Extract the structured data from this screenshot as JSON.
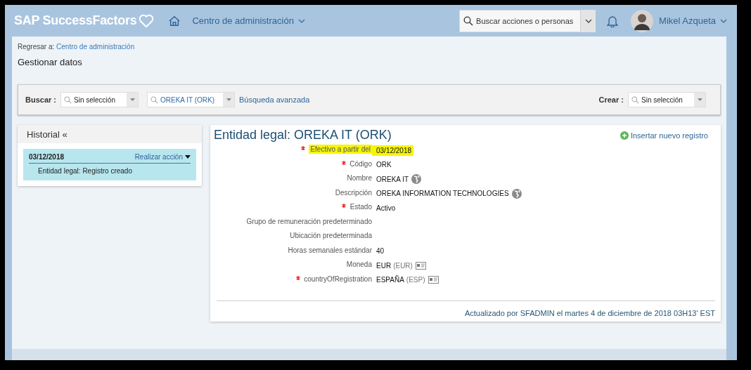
{
  "header": {
    "logo": "SAP SuccessFactors",
    "nav": "Centro de administración",
    "search": {
      "placeholder": "Buscar acciones o personas"
    },
    "user": "Mikel Azqueta"
  },
  "breadcrumb": {
    "label": "Regresar a:",
    "link": "Centro de administración"
  },
  "page_title": "Gestionar datos",
  "toolbar": {
    "search_label": "Buscar :",
    "search_combos": [
      {
        "value": "Sin selección",
        "kind": "plain"
      },
      {
        "value": "OREKA IT (ORK)",
        "kind": "link"
      }
    ],
    "advanced_link": "Búsqueda avanzada",
    "create_label": "Crear :",
    "create_combo": {
      "value": "Sin selección"
    }
  },
  "history": {
    "title": "Historial «",
    "entries": [
      {
        "date": "03/12/2018",
        "action": "Realizar acción",
        "description": "Entidad legal: Registro creado",
        "selected": true
      }
    ]
  },
  "detail": {
    "title": "Entidad legal: OREKA IT (ORK)",
    "insert_link": "Insertar nuevo registro",
    "fields": [
      {
        "label": "Efectivo a partir del",
        "value": "03/12/2018",
        "required": true,
        "highlighted": true
      },
      {
        "label": "Código",
        "value": "ORK",
        "required": true,
        "highlighted": false
      },
      {
        "label": "Nombre",
        "value": "OREKA IT",
        "required": false,
        "highlighted": false,
        "kind": "translatable"
      },
      {
        "label": "Descripción",
        "value": "OREKA INFORMATION TECHNOLOGIES",
        "required": false,
        "highlighted": false,
        "kind": "translatable"
      },
      {
        "label": "Estado",
        "value": "Activo",
        "required": true,
        "highlighted": false
      },
      {
        "label": "Grupo de remuneración predeterminado",
        "required": false,
        "highlighted": false
      },
      {
        "label": "Ubicación predeterminada",
        "required": false,
        "highlighted": false
      },
      {
        "label": "Horas semanales estándar",
        "value": "40",
        "required": false,
        "highlighted": false
      },
      {
        "label": "Moneda",
        "value": "EUR",
        "code": "(EUR)",
        "required": false,
        "highlighted": false,
        "kind": "lookup"
      },
      {
        "label": "countryOfRegistration",
        "value": "ESPAÑA",
        "code": "(ESP)",
        "required": true,
        "highlighted": false,
        "kind": "lookup"
      }
    ],
    "footer": "Actualizado por SFADMIN el martes 4 de diciembre de 2018 03H13' EST"
  }
}
